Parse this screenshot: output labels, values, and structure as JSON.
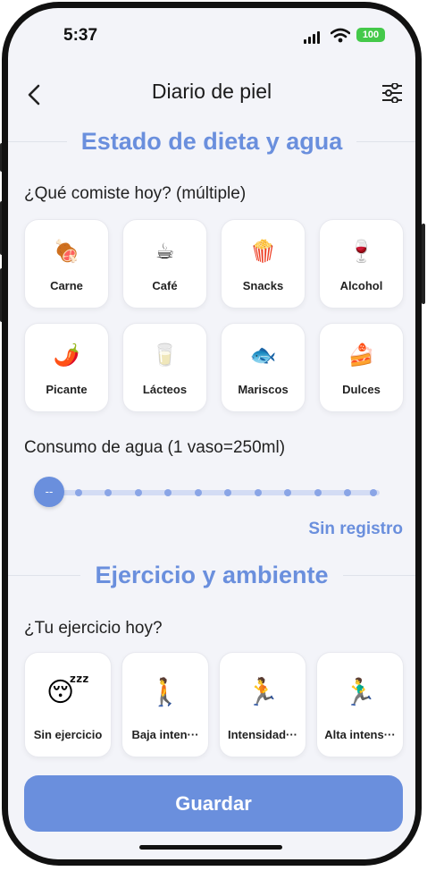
{
  "status": {
    "time": "5:37",
    "battery": "100"
  },
  "header": {
    "title": "Diario de piel"
  },
  "diet": {
    "section_title": "Estado de dieta y agua",
    "question": "¿Qué comiste hoy? (múltiple)",
    "items": [
      {
        "emoji": "🍖",
        "label": "Carne"
      },
      {
        "emoji": "☕",
        "label": "Café"
      },
      {
        "emoji": "🍿",
        "label": "Snacks"
      },
      {
        "emoji": "🍷",
        "label": "Alcohol"
      },
      {
        "emoji": "🌶️",
        "label": "Picante"
      },
      {
        "emoji": "🥛",
        "label": "Lácteos"
      },
      {
        "emoji": "🐟",
        "label": "Mariscos"
      },
      {
        "emoji": "🍰",
        "label": "Dulces"
      }
    ]
  },
  "water": {
    "label": "Consumo de agua  (1 vaso=250ml)",
    "thumb": "--",
    "status": "Sin registro"
  },
  "exercise": {
    "section_title": "Ejercicio y ambiente",
    "question": "¿Tu ejercicio hoy?",
    "items": [
      {
        "emoji": "😴",
        "label": "Sin ejercicio"
      },
      {
        "emoji": "🚶",
        "label": "Baja inten···"
      },
      {
        "emoji": "🏃",
        "label": "Intensidad···"
      },
      {
        "emoji": "🏃‍♂️",
        "label": "Alta intens···"
      }
    ]
  },
  "save_label": "Guardar",
  "colors": {
    "accent": "#6a8fdd",
    "background": "#f3f4f9",
    "battery": "#44c94a"
  }
}
